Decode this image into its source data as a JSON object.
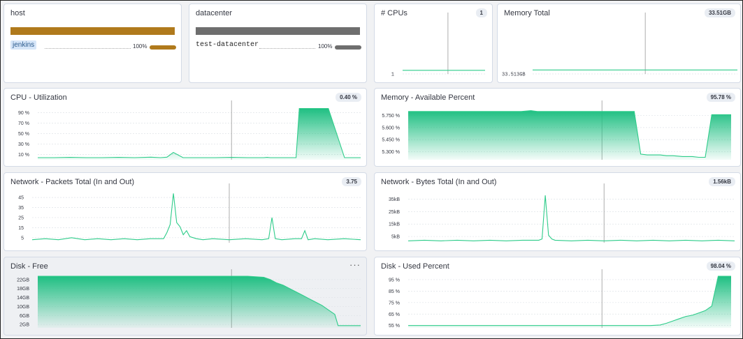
{
  "colors": {
    "accent": "#2ecc8a",
    "area_top": "#1fbf82",
    "host_bar": "#b07a1c",
    "datacenter_bar": "#6e6e6e",
    "chip_bg": "#d6e6f8"
  },
  "host": {
    "title": "host",
    "item": "jenkins",
    "percent": "100%",
    "fill_fraction": 1.0
  },
  "datacenter": {
    "title": "datacenter",
    "item": "test-datacenter",
    "percent": "100%",
    "fill_fraction": 1.0
  },
  "cpus": {
    "title": "# CPUs",
    "value": "1",
    "tick": "1"
  },
  "memory_total": {
    "title": "Memory Total",
    "value": "33.51GB",
    "tick": "33.513GB"
  },
  "cpu_util": {
    "title": "CPU - Utilization",
    "value": "0.40 %",
    "ticks": [
      "90 %",
      "70 %",
      "50 %",
      "30 %",
      "10 %"
    ]
  },
  "mem_avail": {
    "title": "Memory - Available Percent",
    "value": "95.78 %",
    "ticks": [
      "5.750 %",
      "5.600 %",
      "5.450 %",
      "5.300 %"
    ]
  },
  "net_packets": {
    "title": "Network - Packets Total (In and Out)",
    "value": "3.75",
    "ticks": [
      "45",
      "35",
      "25",
      "15",
      "5"
    ]
  },
  "net_bytes": {
    "title": "Network - Bytes Total (In and Out)",
    "value": "1.56kB",
    "ticks": [
      "35kB",
      "25kB",
      "15kB",
      "5kB"
    ]
  },
  "disk_free": {
    "title": "Disk - Free",
    "menu": "···",
    "ticks": [
      "22GB",
      "18GB",
      "14GB",
      "10GB",
      "6GB",
      "2GB"
    ]
  },
  "disk_used": {
    "title": "Disk - Used Percent",
    "value": "98.04 %",
    "ticks": [
      "95 %",
      "85 %",
      "75 %",
      "65 %",
      "55 %"
    ]
  },
  "chart_data": [
    {
      "type": "line",
      "title": "# CPUs",
      "x": [
        0,
        1
      ],
      "series": [
        {
          "values": [
            1,
            1
          ]
        }
      ],
      "ylim": [
        0.5,
        8
      ]
    },
    {
      "type": "line",
      "title": "Memory Total",
      "x": [
        0,
        1
      ],
      "series": [
        {
          "values": [
            33.513,
            33.513
          ]
        }
      ],
      "ylim": [
        33.0,
        40.0
      ]
    },
    {
      "type": "area",
      "title": "CPU - Utilization",
      "x": [
        0,
        5,
        10,
        15,
        20,
        25,
        30,
        35,
        38,
        40,
        42,
        45,
        50,
        55,
        60,
        65,
        68,
        69,
        70,
        71,
        72,
        73,
        74,
        75,
        76,
        77,
        78,
        79,
        80,
        81,
        82,
        84,
        86,
        90,
        95,
        100
      ],
      "series": [
        {
          "values": [
            4,
            4,
            4.5,
            4,
            4,
            4.5,
            4,
            5,
            4,
            5,
            14,
            4,
            4,
            4,
            4.5,
            4,
            4,
            4,
            4,
            4.5,
            4,
            4,
            4,
            4,
            4,
            4,
            4,
            4,
            4,
            98,
            98,
            98,
            98,
            98,
            4,
            4
          ]
        }
      ],
      "ylim": [
        0,
        100
      ]
    },
    {
      "type": "area",
      "title": "Memory - Available Percent",
      "x": [
        0,
        10,
        20,
        30,
        35,
        38,
        40,
        45,
        50,
        55,
        60,
        65,
        70,
        72,
        74,
        76,
        78,
        80,
        82,
        85,
        88,
        90,
        92,
        94,
        95,
        100
      ],
      "series": [
        {
          "values": [
            5.8,
            5.8,
            5.8,
            5.8,
            5.8,
            5.81,
            5.8,
            5.8,
            5.8,
            5.8,
            5.8,
            5.8,
            5.8,
            5.27,
            5.26,
            5.26,
            5.26,
            5.25,
            5.25,
            5.24,
            5.24,
            5.23,
            5.23,
            5.76,
            5.76,
            5.76
          ]
        }
      ],
      "ylim": [
        5.2,
        5.85
      ]
    },
    {
      "type": "line",
      "title": "Network - Packets Total (In and Out)",
      "x": [
        0,
        4,
        8,
        12,
        16,
        20,
        24,
        28,
        32,
        36,
        40,
        41,
        42,
        43,
        44,
        45,
        46,
        47,
        48,
        50,
        52,
        55,
        60,
        65,
        70,
        72,
        73,
        74,
        76,
        80,
        82,
        83,
        84,
        86,
        90,
        95,
        100
      ],
      "series": [
        {
          "values": [
            3,
            4,
            3,
            5,
            3,
            4,
            3,
            4,
            3,
            4,
            4,
            10,
            18,
            49,
            20,
            16,
            8,
            12,
            6,
            4,
            3,
            4,
            3,
            4,
            3,
            4,
            25,
            4,
            3,
            4,
            4,
            12,
            3,
            4,
            3,
            4,
            3
          ]
        }
      ],
      "ylim": [
        0,
        52
      ]
    },
    {
      "type": "line",
      "title": "Network - Bytes Total (In and Out)",
      "x": [
        0,
        5,
        10,
        15,
        20,
        25,
        30,
        35,
        40,
        41,
        42,
        43,
        44,
        45,
        50,
        55,
        60,
        65,
        70,
        75,
        80,
        85,
        90,
        95,
        100
      ],
      "series": [
        {
          "values": [
            1.5,
            2,
            1.5,
            2,
            1.5,
            2,
            1.5,
            2,
            2,
            3,
            38,
            6,
            3,
            2,
            1.5,
            2,
            1.5,
            2,
            1.5,
            2,
            1.5,
            2,
            1.5,
            2,
            1.5
          ]
        }
      ],
      "ylim": [
        0,
        42
      ]
    },
    {
      "type": "area",
      "title": "Disk - Free",
      "x": [
        0,
        10,
        20,
        30,
        40,
        50,
        60,
        65,
        70,
        72,
        74,
        76,
        78,
        80,
        82,
        84,
        86,
        88,
        90,
        92,
        93,
        100
      ],
      "series": [
        {
          "values": [
            23.5,
            23.5,
            23.5,
            23.5,
            23.5,
            23.5,
            23.5,
            23.5,
            23,
            22,
            20.5,
            19.5,
            18,
            16.5,
            15,
            13.5,
            12,
            10.5,
            8.5,
            6.5,
            1.5,
            1.5
          ]
        }
      ],
      "ylim": [
        0.5,
        23.5
      ]
    },
    {
      "type": "area",
      "title": "Disk - Used Percent",
      "x": [
        0,
        10,
        20,
        30,
        40,
        50,
        60,
        70,
        75,
        78,
        80,
        82,
        84,
        86,
        88,
        90,
        92,
        94,
        96,
        98,
        100
      ],
      "series": [
        {
          "values": [
            55,
            55,
            55,
            55,
            55,
            55,
            55,
            55,
            55,
            55.5,
            57,
            59,
            61,
            63,
            64,
            66,
            68,
            72,
            98,
            98,
            98
          ]
        }
      ],
      "ylim": [
        53,
        98
      ]
    }
  ]
}
